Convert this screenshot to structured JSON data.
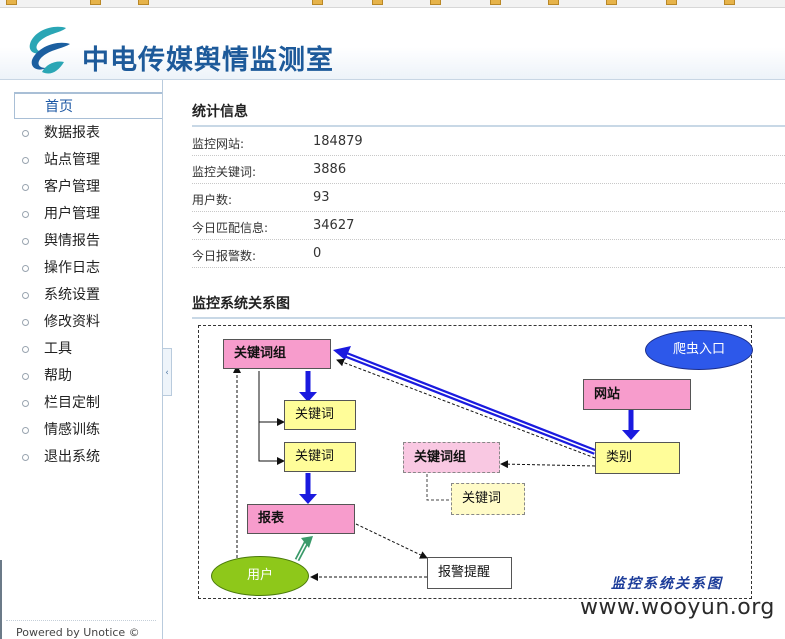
{
  "header": {
    "title": "中电传媒舆情监测室"
  },
  "sidebar": {
    "items": [
      {
        "label": "首页",
        "active": true
      },
      {
        "label": "数据报表"
      },
      {
        "label": "站点管理"
      },
      {
        "label": "客户管理"
      },
      {
        "label": "用户管理"
      },
      {
        "label": "舆情报告"
      },
      {
        "label": "操作日志"
      },
      {
        "label": "系统设置"
      },
      {
        "label": "修改资料"
      },
      {
        "label": "工具"
      },
      {
        "label": "帮助"
      },
      {
        "label": "栏目定制"
      },
      {
        "label": "情感训练"
      },
      {
        "label": "退出系统"
      }
    ],
    "footer": "Powered by Unotice ©"
  },
  "collapse_glyph": "‹",
  "stats": {
    "title": "统计信息",
    "rows": [
      {
        "label": "监控网站:",
        "value": "184879"
      },
      {
        "label": "监控关键词:",
        "value": "3886"
      },
      {
        "label": "用户数:",
        "value": "93"
      },
      {
        "label": "今日匹配信息:",
        "value": "34627"
      },
      {
        "label": "今日报警数:",
        "value": "0"
      }
    ]
  },
  "diagram": {
    "title": "监控系统关系图",
    "caption": "监控系统关系图",
    "nodes": {
      "keyword_group": "关键词组",
      "keyword_1": "关键词",
      "keyword_2": "关键词",
      "report": "报表",
      "crawler": "爬虫入口",
      "website": "网站",
      "category": "类别",
      "keyword_group_2": "关键词组",
      "keyword_3": "关键词",
      "alert": "报警提醒",
      "user": "用户"
    }
  },
  "watermark": "www.wooyun.org",
  "colors": {
    "pink": "#f79ccc",
    "yellow": "#fffd99",
    "arrow_blue": "#1a1adf",
    "crawler_blue": "#2d58ea",
    "user_green": "#8ec81a",
    "title_blue": "#1d5a9a"
  }
}
